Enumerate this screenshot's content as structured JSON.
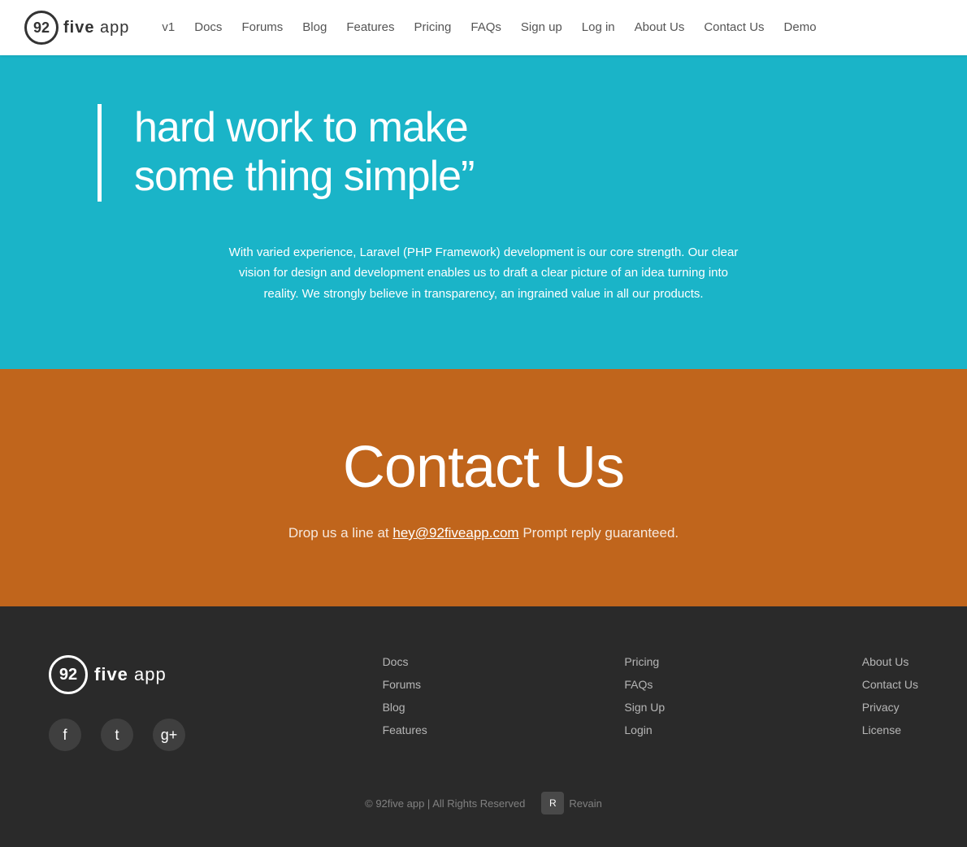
{
  "nav": {
    "logo": {
      "circle_text": "92",
      "text_part1": "five",
      "text_part2": "app"
    },
    "links": [
      {
        "id": "v1",
        "label": "v1",
        "href": "#"
      },
      {
        "id": "docs",
        "label": "Docs",
        "href": "#"
      },
      {
        "id": "forums",
        "label": "Forums",
        "href": "#"
      },
      {
        "id": "blog",
        "label": "Blog",
        "href": "#"
      },
      {
        "id": "features",
        "label": "Features",
        "href": "#"
      },
      {
        "id": "pricing",
        "label": "Pricing",
        "href": "#"
      },
      {
        "id": "faqs",
        "label": "FAQs",
        "href": "#"
      },
      {
        "id": "signup",
        "label": "Sign up",
        "href": "#"
      },
      {
        "id": "login",
        "label": "Log in",
        "href": "#"
      },
      {
        "id": "about",
        "label": "About Us",
        "href": "#"
      },
      {
        "id": "contact",
        "label": "Contact Us",
        "href": "#"
      },
      {
        "id": "demo",
        "label": "Demo",
        "href": "#"
      }
    ]
  },
  "hero": {
    "quote_line1": "hard work to make",
    "quote_line2": "some thing simple”",
    "description": "With varied experience, Laravel (PHP Framework) development is our core strength. Our clear vision for design and development enables us to draft a clear picture of an idea turning into reality. We strongly believe in transparency, an ingrained value in all our products."
  },
  "contact": {
    "title": "Contact Us",
    "subtitle_before": "Drop us a line at ",
    "email": "hey@92fiveapp.com",
    "subtitle_after": " Prompt reply guaranteed."
  },
  "footer": {
    "logo": {
      "circle_text": "92",
      "text_part1": "five",
      "text_part2": "app"
    },
    "social": [
      {
        "id": "facebook",
        "icon": "f",
        "label": "Facebook"
      },
      {
        "id": "twitter",
        "icon": "t",
        "label": "Twitter"
      },
      {
        "id": "googleplus",
        "icon": "g+",
        "label": "Google Plus"
      }
    ],
    "links_col1": [
      {
        "id": "docs",
        "label": "Docs",
        "href": "#"
      },
      {
        "id": "forums",
        "label": "Forums",
        "href": "#"
      },
      {
        "id": "blog",
        "label": "Blog",
        "href": "#"
      },
      {
        "id": "features",
        "label": "Features",
        "href": "#"
      }
    ],
    "links_col2": [
      {
        "id": "pricing",
        "label": "Pricing",
        "href": "#"
      },
      {
        "id": "faqs",
        "label": "FAQs",
        "href": "#"
      },
      {
        "id": "signup",
        "label": "Sign Up",
        "href": "#"
      },
      {
        "id": "login",
        "label": "Login",
        "href": "#"
      }
    ],
    "links_col3": [
      {
        "id": "about",
        "label": "About Us",
        "href": "#"
      },
      {
        "id": "contact",
        "label": "Contact Us",
        "href": "#"
      },
      {
        "id": "privacy",
        "label": "Privacy",
        "href": "#"
      },
      {
        "id": "license",
        "label": "License",
        "href": "#"
      }
    ],
    "copyright": "© 92five app | All Rights Reserved",
    "revain_label": "Revain"
  }
}
